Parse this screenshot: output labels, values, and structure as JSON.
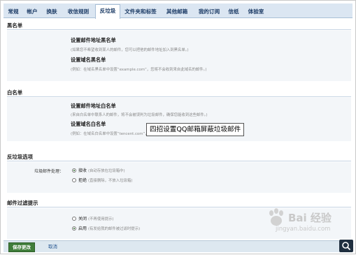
{
  "tabs": [
    {
      "label": "常规"
    },
    {
      "label": "帐户"
    },
    {
      "label": "换肤"
    },
    {
      "label": "收信规则"
    },
    {
      "label": "反垃圾"
    },
    {
      "label": "文件夹和标签"
    },
    {
      "label": "其他邮箱"
    },
    {
      "label": "我的订阅"
    },
    {
      "label": "信纸"
    },
    {
      "label": "体验室"
    }
  ],
  "blacklist": {
    "title": "黑名单",
    "set_address": {
      "label": "设置邮件地址黑名单",
      "hint": "(如果您不希望收到某人的邮件，您可以把他的邮件地址加入到黑名单。)"
    },
    "set_domain": {
      "label": "设置域名黑名单",
      "hint": "(例如：在域名黑名单中设置“example.com”，您将不会收到来自此域名的邮件。)"
    }
  },
  "whitelist": {
    "title": "白名单",
    "set_address": {
      "label": "设置邮件地址白名单",
      "hint": "(来自白名单中联系人的邮件，将不会被误判为垃圾邮件，确保您能收到这些邮件。)"
    },
    "set_domain": {
      "label": "设置域名白名单",
      "hint": "(例如：在域名白名单中设置“tencent.com”，您将会收到来自@tencent.com发来的所有邮件。)"
    }
  },
  "antispam": {
    "title": "反垃圾选项",
    "handling_label": "垃圾邮件处理：",
    "options": [
      {
        "label": "接收",
        "note": "(自动存放在垃圾箱中)",
        "selected": true
      },
      {
        "label": "拒绝",
        "note": "(直接删除，不放入垃圾箱)",
        "selected": false
      }
    ]
  },
  "filter_notice": {
    "title": "邮件过滤提示",
    "options": [
      {
        "label": "关闭",
        "note": "(不再使用提示)",
        "selected": false
      },
      {
        "label": "启用",
        "note": "(有发给我的邮件被过滤时提示)",
        "selected": true
      }
    ]
  },
  "overlay_caption": "四招设置QQ邮箱屏蔽垃圾邮件",
  "buttons": {
    "save": "保存更改",
    "cancel": "取消"
  },
  "watermark": {
    "brand": "Bai 经验",
    "url": "jingyan.baidu.com"
  },
  "colors": {
    "tab_bg": "#dbe6f2",
    "save_green": "#3f7d3a",
    "link_blue": "#1d4f8c"
  },
  "icons": {
    "zoom": "magnifier-icon",
    "paw": "baidu-paw-icon"
  }
}
